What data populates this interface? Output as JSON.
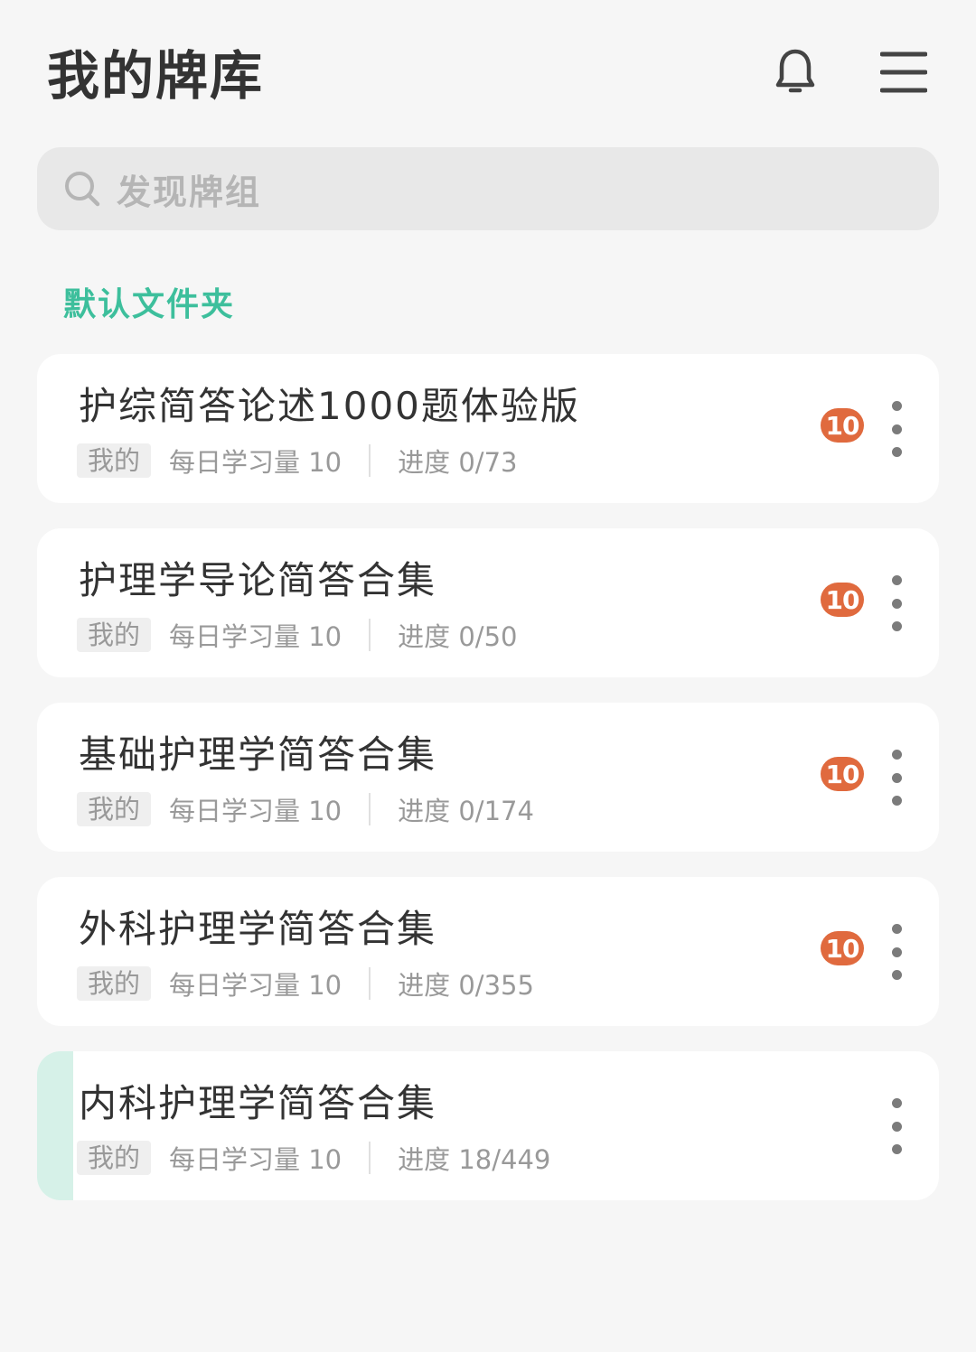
{
  "header": {
    "title": "我的牌库",
    "icons": {
      "notifications": "bell-icon",
      "menu": "hamburger-menu-icon"
    }
  },
  "search": {
    "placeholder": "发现牌组",
    "icon": "search-icon"
  },
  "folder": {
    "title": "默认文件夹"
  },
  "colors": {
    "accent": "#3dbf9c",
    "badge": "#e06a3e",
    "highlight": "#d6f1e8",
    "background": "#f6f6f6"
  },
  "decks": [
    {
      "title": "护综简答论述1000题体验版",
      "tag": "我的",
      "daily": "每日学习量 10",
      "progress": "进度 0/73",
      "badge": "10",
      "highlighted": false
    },
    {
      "title": "护理学导论简答合集",
      "tag": "我的",
      "daily": "每日学习量 10",
      "progress": "进度 0/50",
      "badge": "10",
      "highlighted": false
    },
    {
      "title": "基础护理学简答合集",
      "tag": "我的",
      "daily": "每日学习量 10",
      "progress": "进度 0/174",
      "badge": "10",
      "highlighted": false
    },
    {
      "title": "外科护理学简答合集",
      "tag": "我的",
      "daily": "每日学习量 10",
      "progress": "进度 0/355",
      "badge": "10",
      "highlighted": false
    },
    {
      "title": "内科护理学简答合集",
      "tag": "我的",
      "daily": "每日学习量 10",
      "progress": "进度 18/449",
      "badge": "",
      "highlighted": true
    }
  ]
}
